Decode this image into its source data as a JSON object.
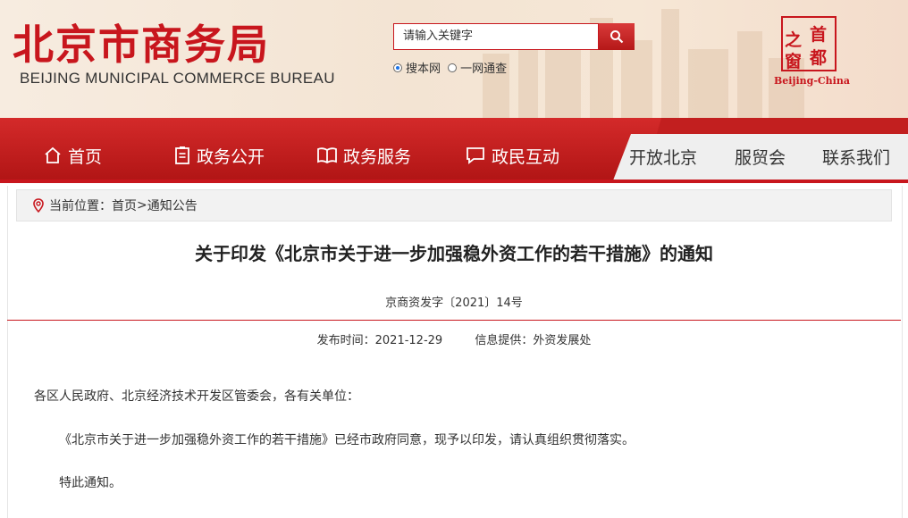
{
  "header": {
    "logo_cn": "北京市商务局",
    "logo_en": "BEIJING MUNICIPAL COMMERCE BUREAU",
    "search": {
      "placeholder": "请输入关键字"
    },
    "scope_options": [
      {
        "label": "搜本网",
        "selected": true
      },
      {
        "label": "一网通查",
        "selected": false
      }
    ],
    "badge": {
      "chars": [
        "首",
        "都",
        "之",
        "窗"
      ],
      "en": "Beijing-China"
    }
  },
  "nav": {
    "primary": [
      {
        "label": "首页",
        "icon": "home-icon"
      },
      {
        "label": "政务公开",
        "icon": "clipboard-icon"
      },
      {
        "label": "政务服务",
        "icon": "book-icon"
      },
      {
        "label": "政民互动",
        "icon": "chat-icon"
      }
    ],
    "secondary": [
      {
        "label": "开放北京"
      },
      {
        "label": "服贸会"
      },
      {
        "label": "联系我们"
      }
    ]
  },
  "breadcrumb": {
    "prefix": "当前位置：",
    "home": "首页",
    "separator": ">",
    "current": "通知公告"
  },
  "article": {
    "title": "关于印发《北京市关于进一步加强稳外资工作的若干措施》的通知",
    "doc_no": "京商资发字〔2021〕14号",
    "published": "发布时间：2021-12-29",
    "source": "信息提供：外资发展处",
    "paragraphs": [
      "各区人民政府、北京经济技术开发区管委会，各有关单位：",
      "《北京市关于进一步加强稳外资工作的若干措施》已经市政府同意，现予以印发，请认真组织贯彻落实。",
      "特此通知。"
    ]
  },
  "colors": {
    "brand_red": "#c8161d",
    "nav_gray": "#efefef",
    "crumb_bg": "#f2f2f2"
  }
}
